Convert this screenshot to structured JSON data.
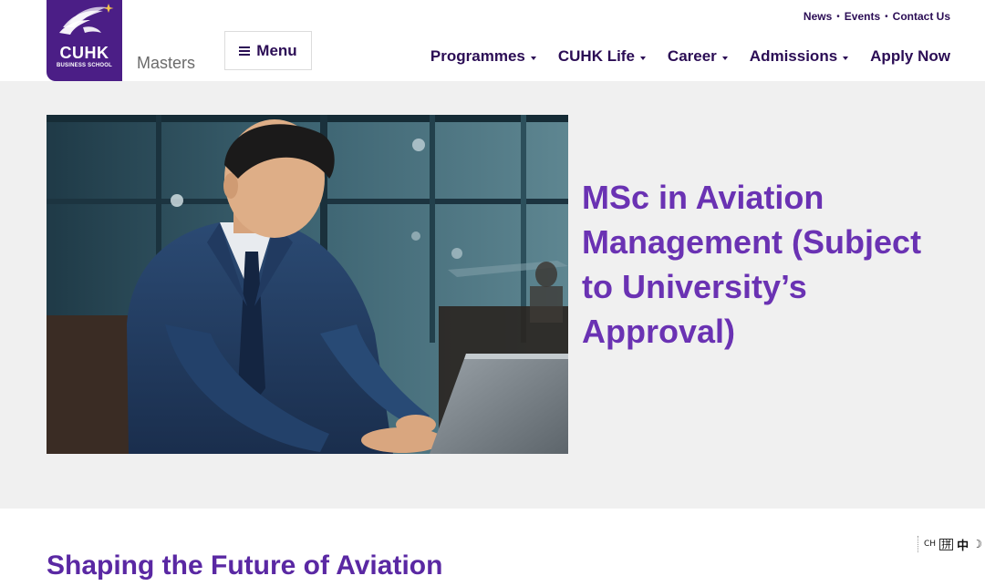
{
  "header": {
    "logo": {
      "name": "CUHK",
      "subtitle": "BUSINESS SCHOOL"
    },
    "site_label": "Masters",
    "menu_button": {
      "label": "Menu",
      "icon": "hamburger-icon"
    },
    "utility_links": [
      "News",
      "Events",
      "Contact Us"
    ],
    "utility_separator": "•",
    "nav": [
      {
        "label": "Programmes",
        "dropdown": true
      },
      {
        "label": "CUHK Life",
        "dropdown": true
      },
      {
        "label": "Career",
        "dropdown": true
      },
      {
        "label": "Admissions",
        "dropdown": true
      },
      {
        "label": "Apply Now",
        "dropdown": false
      }
    ]
  },
  "hero": {
    "title": "MSc in Aviation Management (Subject to University’s Approval)",
    "image": "businessman-typing-on-laptop-in-airport-lounge"
  },
  "section": {
    "title": "Shaping the Future of Aviation"
  },
  "lang_widget": {
    "ch": "CH",
    "pin": "拼",
    "zh": "中",
    "moon": "☽"
  },
  "colors": {
    "brand_purple": "#4b1e86",
    "title_purple": "#6a32b3",
    "nav_text": "#2b0d55",
    "hero_bg": "#f0f0f0"
  }
}
